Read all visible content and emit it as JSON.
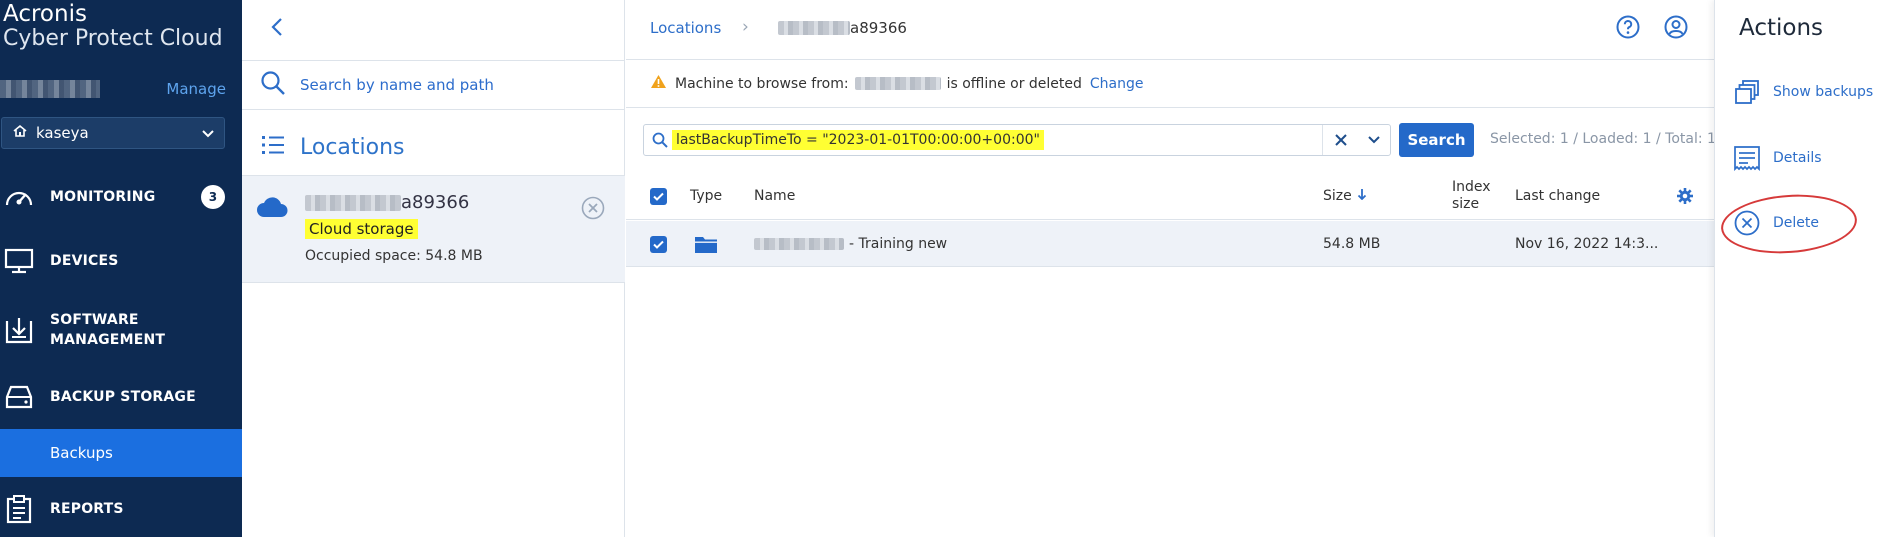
{
  "brand": {
    "line1": "Acronis",
    "line2": "Cyber Protect Cloud"
  },
  "sidebar": {
    "manage_label": "Manage",
    "tenant": "kaseya",
    "items": [
      {
        "label": "MONITORING",
        "badge": "3"
      },
      {
        "label": "DEVICES"
      },
      {
        "label": "SOFTWARE",
        "label2": "MANAGEMENT"
      },
      {
        "label": "BACKUP STORAGE"
      },
      {
        "label": "REPORTS"
      }
    ],
    "sub_item": "Backups"
  },
  "locations_panel": {
    "search_placeholder": "Search by name and path",
    "title": "Locations",
    "item": {
      "name_suffix": "a89366",
      "type": "Cloud storage",
      "occupied": "Occupied space: 54.8 MB"
    }
  },
  "main": {
    "breadcrumb": {
      "root": "Locations",
      "current_suffix": "a89366"
    },
    "warning": {
      "prefix": "Machine to browse from:",
      "suffix": "is offline or deleted",
      "change_link": "Change"
    },
    "filter": {
      "query": "lastBackupTimeTo = \"2023-01-01T00:00:00+00:00\"",
      "search_button": "Search",
      "selection_info": "Selected: 1 / Loaded: 1 / Total: 1"
    },
    "table": {
      "columns": {
        "type": "Type",
        "name": "Name",
        "size": "Size",
        "index_size_1": "Index",
        "index_size_2": "size",
        "last_change": "Last change"
      },
      "rows": [
        {
          "name_suffix": "- Training new",
          "size": "54.8 MB",
          "index_size": "",
          "last_change": "Nov 16, 2022 14:3..."
        }
      ]
    }
  },
  "actions": {
    "title": "Actions",
    "items": [
      {
        "label": "Show backups"
      },
      {
        "label": "Details"
      },
      {
        "label": "Delete"
      }
    ]
  },
  "colors": {
    "sidebar_bg": "#0d2a52",
    "accent": "#2469c9",
    "highlight": "#ffff33",
    "annotation": "#d63a3a"
  }
}
